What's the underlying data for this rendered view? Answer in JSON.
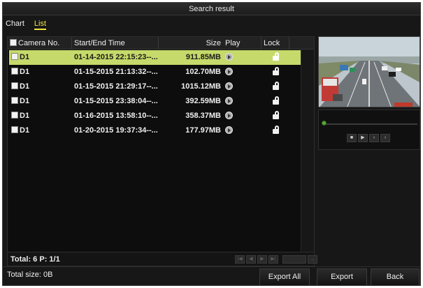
{
  "window": {
    "title": "Search result"
  },
  "tabs": [
    {
      "label": "Chart",
      "active": false
    },
    {
      "label": "List",
      "active": true
    }
  ],
  "table": {
    "columns": [
      "Camera No.",
      "Start/End Time",
      "Size",
      "Play",
      "Lock"
    ],
    "rows": [
      {
        "camera": "D1",
        "time": "01-14-2015 22:15:23--...",
        "size": "911.85MB",
        "selected": true
      },
      {
        "camera": "D1",
        "time": "01-15-2015 21:13:32--...",
        "size": "102.70MB",
        "selected": false
      },
      {
        "camera": "D1",
        "time": "01-15-2015 21:29:17--...",
        "size": "1015.12MB",
        "selected": false
      },
      {
        "camera": "D1",
        "time": "01-15-2015 23:38:04--...",
        "size": "392.59MB",
        "selected": false
      },
      {
        "camera": "D1",
        "time": "01-16-2015 13:58:10--...",
        "size": "358.37MB",
        "selected": false
      },
      {
        "camera": "D1",
        "time": "01-20-2015 19:37:34--...",
        "size": "177.97MB",
        "selected": false
      }
    ]
  },
  "footer": {
    "totals": "Total: 6  P: 1/1"
  },
  "bottom": {
    "total_size": "Total size: 0B",
    "export_all_label": "Export All",
    "export_label": "Export",
    "back_label": "Back"
  },
  "icons": {
    "play": "play-circle-icon",
    "lock": "padlock-open-icon",
    "pager": [
      "first-page-icon",
      "prev-page-icon",
      "next-page-icon",
      "last-page-icon"
    ],
    "playback": [
      "stop-icon",
      "play-icon",
      "slow-icon",
      "fast-forward-icon"
    ]
  },
  "colors": {
    "selected_row": "#c5da6a",
    "active_tab": "#f2e43c",
    "seek_knob": "#5da73b"
  }
}
